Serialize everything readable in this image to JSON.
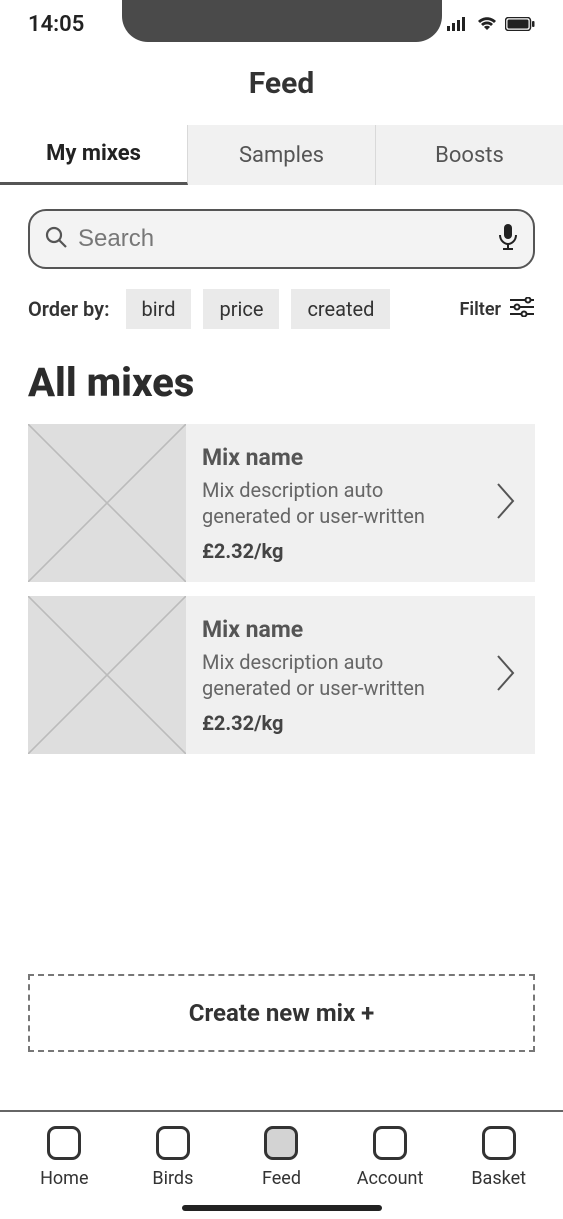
{
  "status": {
    "time": "14:05"
  },
  "header": {
    "title": "Feed"
  },
  "tabs": {
    "my_mixes": "My mixes",
    "samples": "Samples",
    "boosts": "Boosts"
  },
  "search": {
    "placeholder": "Search"
  },
  "order": {
    "label": "Order by:",
    "options": {
      "bird": "bird",
      "price": "price",
      "created": "created"
    },
    "filter_label": "Filter"
  },
  "section": {
    "all_mixes": "All mixes"
  },
  "mixes": [
    {
      "name": "Mix name",
      "description": "Mix description auto generated or user-written",
      "price": "£2.32/kg"
    },
    {
      "name": "Mix name",
      "description": "Mix description auto generated or user-written",
      "price": "£2.32/kg"
    }
  ],
  "create_mix": {
    "label": "Create new mix +"
  },
  "nav": {
    "home": "Home",
    "birds": "Birds",
    "feed": "Feed",
    "account": "Account",
    "basket": "Basket"
  }
}
